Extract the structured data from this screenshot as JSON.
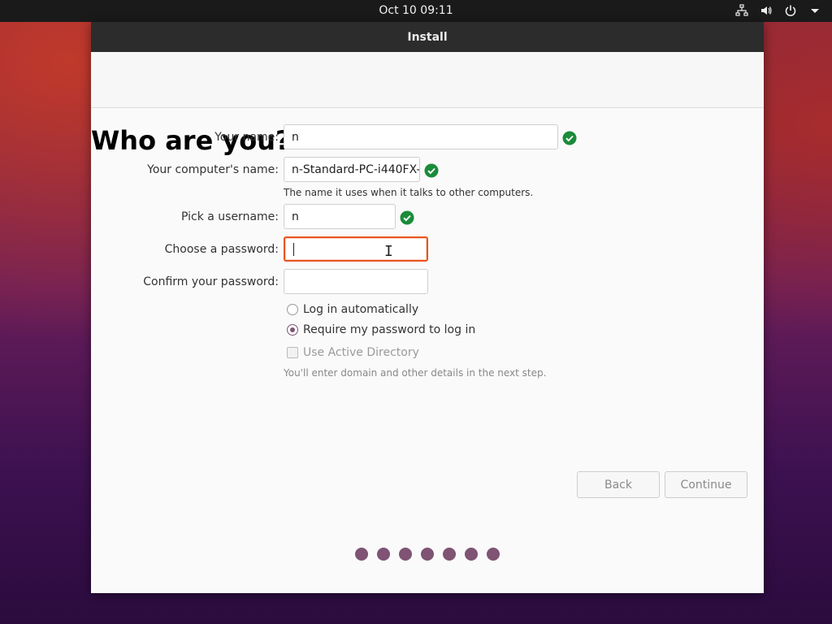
{
  "topbar": {
    "clock": "Oct 10  09:11",
    "icons": [
      "network-icon",
      "volume-icon",
      "power-icon",
      "menu-arrow-icon"
    ]
  },
  "window": {
    "title": "Install",
    "heading": "Who are you?"
  },
  "form": {
    "name_label": "Your name:",
    "name_value": "n",
    "computer_label": "Your computer's name:",
    "computer_value": "n-Standard-PC-i440FX-",
    "computer_hint": "The name it uses when it talks to other computers.",
    "username_label": "Pick a username:",
    "username_value": "n",
    "password_label": "Choose a password:",
    "password_value": "",
    "confirm_label": "Confirm your password:",
    "confirm_value": "",
    "login_auto_label": "Log in automatically",
    "login_auto_selected": false,
    "require_password_label": "Require my password to log in",
    "require_password_selected": true,
    "active_directory_label": "Use Active Directory",
    "active_directory_checked": false,
    "active_directory_enabled": false,
    "active_directory_hint": "You'll enter domain and other details in the next step."
  },
  "buttons": {
    "back": "Back",
    "continue": "Continue"
  },
  "progress": {
    "dots_total": 7
  },
  "colors": {
    "accent": "#e95420",
    "aubergine": "#7e5373",
    "valid": "#1a8b3a"
  }
}
